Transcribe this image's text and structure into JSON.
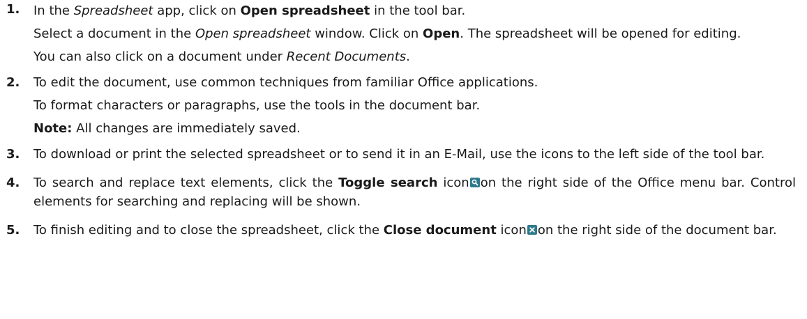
{
  "steps": [
    {
      "number": "1.",
      "lines": [
        {
          "a": "In the ",
          "b": "Spreadsheet",
          "c": " app, click on ",
          "d": "Open spreadsheet",
          "e": " in the tool bar."
        },
        {
          "a": "Select a document in the ",
          "b": "Open spreadsheet",
          "c": " window. Click on ",
          "d": "Open",
          "e": ". The spreadsheet will be opened for editing."
        },
        {
          "a": "You can also click on a document under ",
          "b": "Recent Documents",
          "c": "."
        }
      ]
    },
    {
      "number": "2.",
      "lines": [
        {
          "text": "To edit the document, use common techniques from familiar Office applications."
        },
        {
          "text": "To format characters or paragraphs, use the tools in the document bar."
        },
        {
          "note_label": "Note:",
          "note_text": " All changes are immediately saved."
        }
      ]
    },
    {
      "number": "3.",
      "lines": [
        {
          "text": "To download or print the selected spreadsheet or to send it in an E-Mail, use the icons to the left side of the tool bar."
        }
      ]
    },
    {
      "number": "4.",
      "lines": [
        {
          "a": "To search and replace text elements, click the ",
          "b": "Toggle search",
          "c": " icon",
          "icon": "search-icon",
          "d": "on the right side of the Office menu bar. Control elements for searching and replacing will be shown."
        }
      ]
    },
    {
      "number": "5.",
      "lines": [
        {
          "a": "To finish editing and to close the spreadsheet, click the ",
          "b": "Close document",
          "c": " icon",
          "icon": "close-icon",
          "d": "on the right side of the document bar."
        }
      ]
    }
  ],
  "colors": {
    "icon_background": "#2e7a8c",
    "text": "#1a1a1a"
  }
}
